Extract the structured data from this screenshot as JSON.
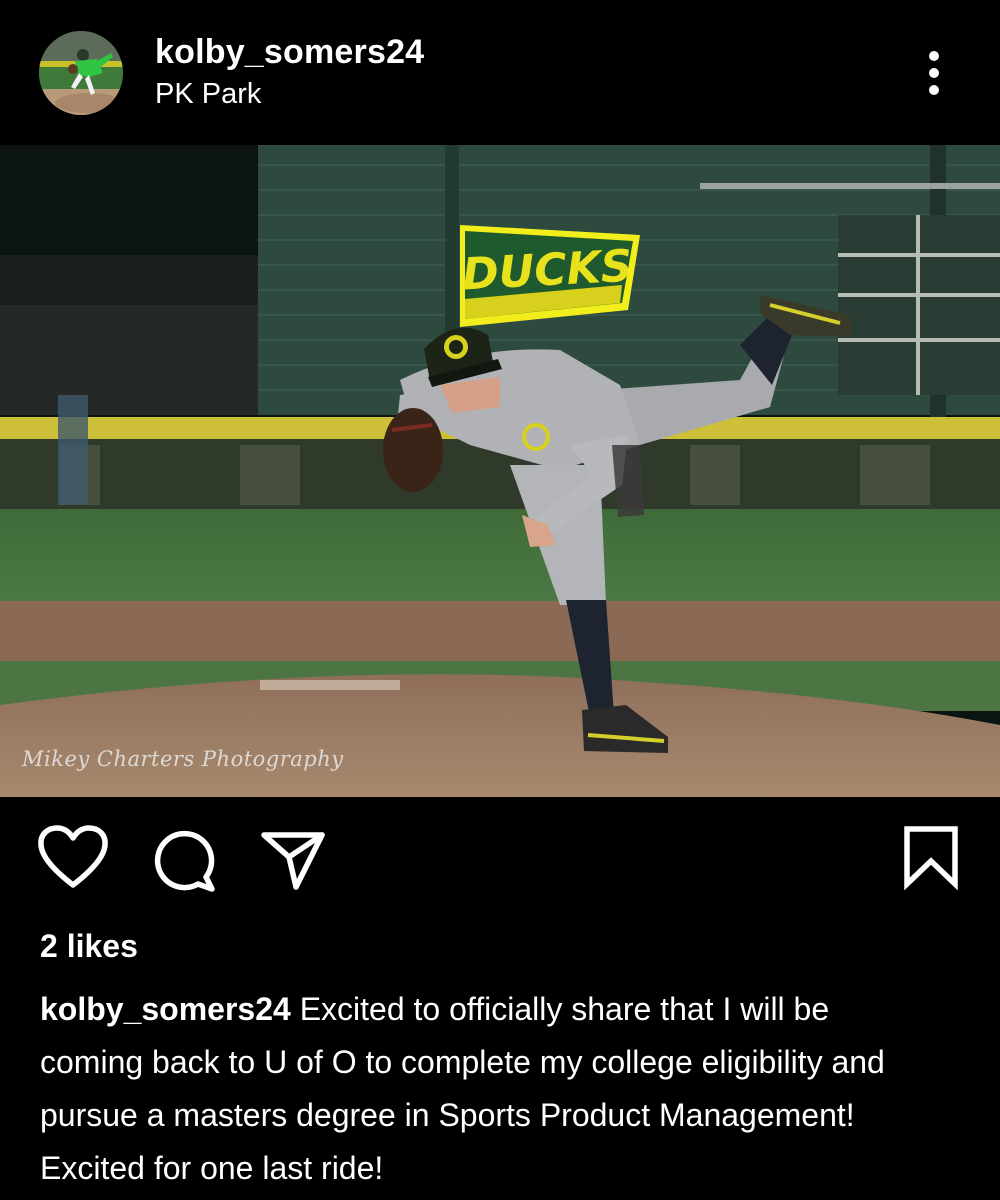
{
  "post": {
    "username": "kolby_somers24",
    "location": "PK Park"
  },
  "icons": {
    "avatar": "profile-photo",
    "more": "more-vertical-icon",
    "like": "heart-icon",
    "comment": "comment-bubble-icon",
    "share": "send-icon",
    "save": "bookmark-icon"
  },
  "photo": {
    "banner_text": "DUCKS",
    "cap_logo": "O",
    "watermark": "Mikey Charters Photography"
  },
  "engagement": {
    "likes": "2 likes"
  },
  "caption": {
    "username": "kolby_somers24",
    "text": "Excited to officially share that I will be coming back to U of O to complete my college eligibility and pursue a masters degree in Sports Product Management! Excited for one last ride!"
  },
  "colors": {
    "background": "#000000",
    "text": "#ffffff",
    "ducks_green": "#1f5a2f",
    "ducks_yellow": "#d7d11e"
  }
}
